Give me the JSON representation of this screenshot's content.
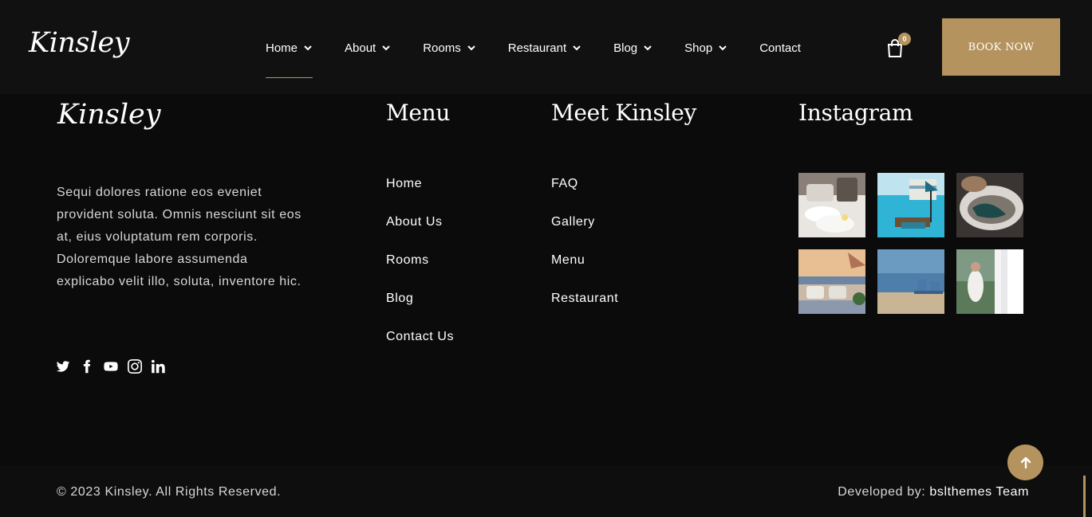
{
  "header": {
    "logo": "Kinsley",
    "nav": [
      {
        "label": "Home",
        "dropdown": true,
        "active": true
      },
      {
        "label": "About",
        "dropdown": true
      },
      {
        "label": "Rooms",
        "dropdown": true
      },
      {
        "label": "Restaurant",
        "dropdown": true
      },
      {
        "label": "Blog",
        "dropdown": true
      },
      {
        "label": "Shop",
        "dropdown": true
      },
      {
        "label": "Contact",
        "dropdown": false
      }
    ],
    "cart_count": "0",
    "book_label": "BOOK NOW"
  },
  "footer": {
    "logo": "Kinsley",
    "about_text": "Sequi dolores ratione eos eveniet provident soluta. Omnis nesciunt sit eos at, eius voluptatum rem corporis. Doloremque labore assumenda explicabo velit illo, soluta, inventore hic.",
    "social": [
      "twitter-icon",
      "facebook-icon",
      "youtube-icon",
      "instagram-icon",
      "linkedin-icon"
    ],
    "menu": {
      "title": "Menu",
      "items": [
        "Home",
        "About Us",
        "Rooms",
        "Blog",
        "Contact Us"
      ]
    },
    "meet": {
      "title": "Meet Kinsley",
      "items": [
        "FAQ",
        "Gallery",
        "Menu",
        "Restaurant"
      ]
    },
    "instagram": {
      "title": "Instagram",
      "images": [
        "towels-on-bed",
        "pool-with-umbrella",
        "woman-in-bath",
        "terrace-with-chairs",
        "beach-chairs",
        "woman-at-window"
      ]
    }
  },
  "bottom": {
    "copyright": "© 2023 Kinsley. All Rights Reserved.",
    "dev_prefix": "Developed by: ",
    "dev_team": "bslthemes Team"
  },
  "colors": {
    "accent": "#b5935e",
    "header_bg": "#111111",
    "page_bg": "#0b0b0b"
  }
}
